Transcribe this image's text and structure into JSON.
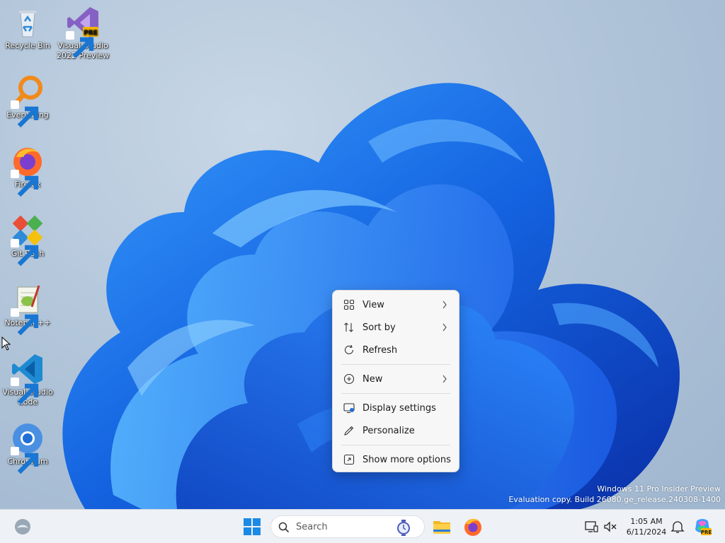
{
  "desktop": {
    "icons": [
      {
        "label": "Recycle Bin",
        "icon": "recycle-bin-icon",
        "shortcut": false
      },
      {
        "label": "Visual Studio 2022 Preview",
        "icon": "visual-studio-icon",
        "badge": "PRE",
        "shortcut": true
      },
      {
        "label": "Everything",
        "icon": "everything-search-icon",
        "shortcut": true
      },
      {
        "label": "Firefox",
        "icon": "firefox-icon",
        "shortcut": true
      },
      {
        "label": "Git Bash",
        "icon": "git-bash-icon",
        "shortcut": true
      },
      {
        "label": "Notepad++",
        "icon": "notepad-plus-plus-icon",
        "shortcut": true
      },
      {
        "label": "Visual Studio Code",
        "icon": "vscode-icon",
        "shortcut": true
      },
      {
        "label": "Chromium",
        "icon": "chromium-icon",
        "shortcut": true
      }
    ],
    "watermark": {
      "line1": "Windows 11 Pro Insider Preview",
      "line2": "Evaluation copy. Build 26080.ge_release.240308-1400"
    }
  },
  "context_menu": {
    "items": [
      {
        "label": "View",
        "icon": "grid-view-icon",
        "submenu": true
      },
      {
        "label": "Sort by",
        "icon": "sort-arrows-icon",
        "submenu": true
      },
      {
        "label": "Refresh",
        "icon": "refresh-icon",
        "submenu": false
      },
      {
        "label": "New",
        "icon": "plus-circle-icon",
        "submenu": true
      },
      {
        "label": "Display settings",
        "icon": "display-settings-icon",
        "submenu": false
      },
      {
        "label": "Personalize",
        "icon": "pen-icon",
        "submenu": false
      },
      {
        "label": "Show more options",
        "icon": "more-options-icon",
        "submenu": false
      }
    ]
  },
  "taskbar": {
    "search_label": "Search",
    "pinned": [
      "widgets-icon",
      "start-icon",
      "file-explorer-icon",
      "firefox-icon"
    ],
    "tray": [
      "network-display-icon",
      "speaker-battery-icon",
      "notification-bell-icon",
      "copilot-pre-icon"
    ],
    "tray_badge": "PRE",
    "clock": {
      "time": "1:05 AM",
      "date": "6/11/2024"
    }
  },
  "colors": {
    "accent": "#0f62d6",
    "taskbar": "#eef1f5",
    "menu_bg": "#f7f7f7"
  }
}
